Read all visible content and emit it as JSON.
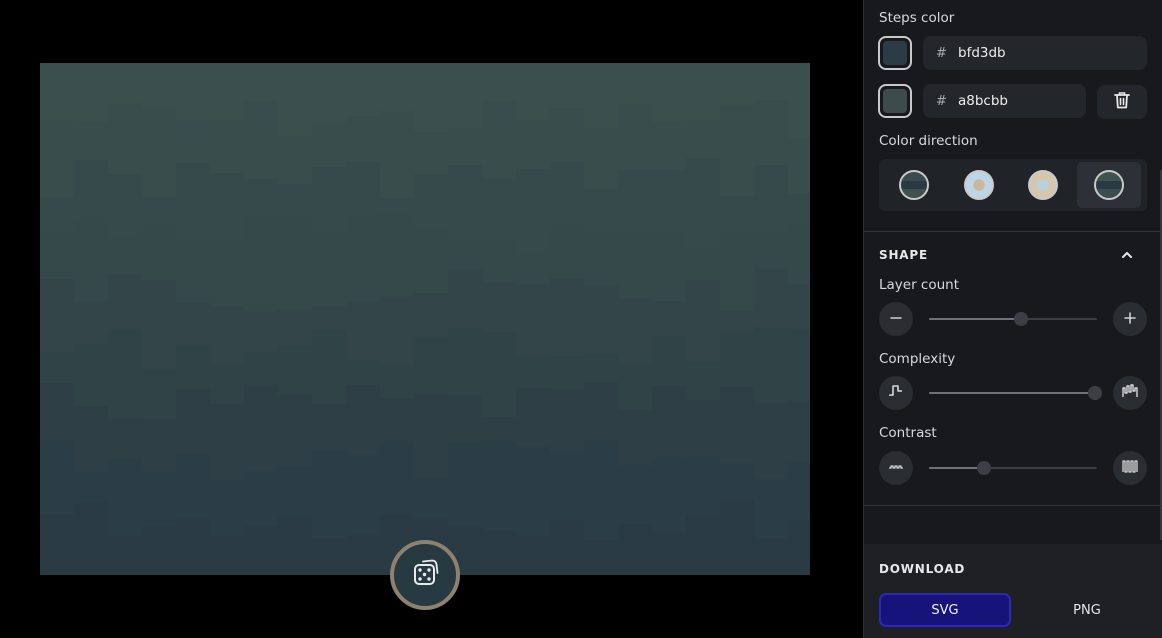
{
  "canvas": {
    "base_color": "#3a4f4f",
    "top_color": "#3b4f4d",
    "bottom_color": "#2a3b44",
    "randomize_icon": "dice-icon"
  },
  "panel": {
    "steps_color": {
      "label": "Steps color",
      "colors": [
        {
          "hash": "#",
          "value": "bfd3db",
          "swatch": "#2b3c46"
        },
        {
          "hash": "#",
          "value": "a8bcbb",
          "swatch": "#3d4c4b"
        }
      ],
      "delete_icon": "trash-icon"
    },
    "color_direction": {
      "label": "Color direction",
      "options": [
        {
          "name": "dark-bands",
          "colors": [
            "#3a4a50",
            "#2b3a42",
            "#40524f"
          ]
        },
        {
          "name": "light-blue-center",
          "colors": [
            "#bcd6e6",
            "#cab79e"
          ]
        },
        {
          "name": "light-beige-center",
          "colors": [
            "#d5c6b0",
            "#b9d1df"
          ]
        },
        {
          "name": "dark-bands-alt",
          "colors": [
            "#3b4d4e",
            "#2a3a43",
            "#41534f"
          ]
        }
      ],
      "active_index": 3
    },
    "shape": {
      "title": "SHAPE",
      "collapse_icon": "chevron-up-icon",
      "layer_count": {
        "label": "Layer count",
        "value": 0.55,
        "minus_icon": "minus-icon",
        "plus_icon": "plus-icon"
      },
      "complexity": {
        "label": "Complexity",
        "value": 0.99,
        "low_icon": "step-simple-icon",
        "high_icon": "step-complex-icon"
      },
      "contrast": {
        "label": "Contrast",
        "value": 0.33,
        "low_icon": "wave-low-icon",
        "high_icon": "wave-high-icon"
      }
    },
    "download": {
      "title": "DOWNLOAD",
      "svg_label": "SVG",
      "png_label": "PNG",
      "accent": "#16147a"
    }
  }
}
